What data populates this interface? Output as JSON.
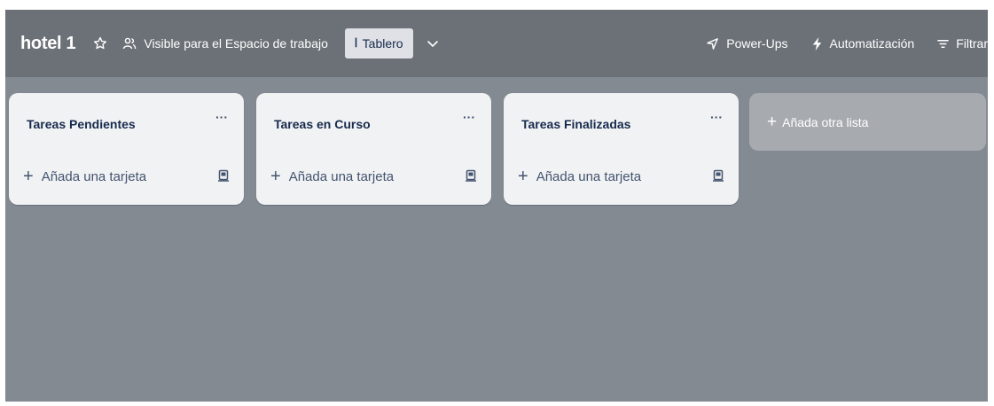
{
  "header": {
    "board_title": "hotel 1",
    "star_icon": "star-icon",
    "visibility_label": "Visible para el Espacio de trabajo",
    "view_glyph": "ꟾ",
    "view_label": "Tablero",
    "power_ups_label": "Power-Ups",
    "automation_label": "Automatización",
    "filter_label": "Filtrar"
  },
  "lists": [
    {
      "title": "Tareas Pendientes",
      "menu": "···",
      "add_card": "Añada una tarjeta"
    },
    {
      "title": "Tareas en Curso",
      "menu": "···",
      "add_card": "Añada una tarjeta"
    },
    {
      "title": "Tareas Finalizadas",
      "menu": "···",
      "add_card": "Añada una tarjeta"
    }
  ],
  "add_list_label": "Añada otra lista",
  "colors": {
    "header_bg": "#6b7177",
    "board_bg": "#838a92",
    "list_bg": "#f1f2f4",
    "add_list_bg": "#a7abb0"
  }
}
